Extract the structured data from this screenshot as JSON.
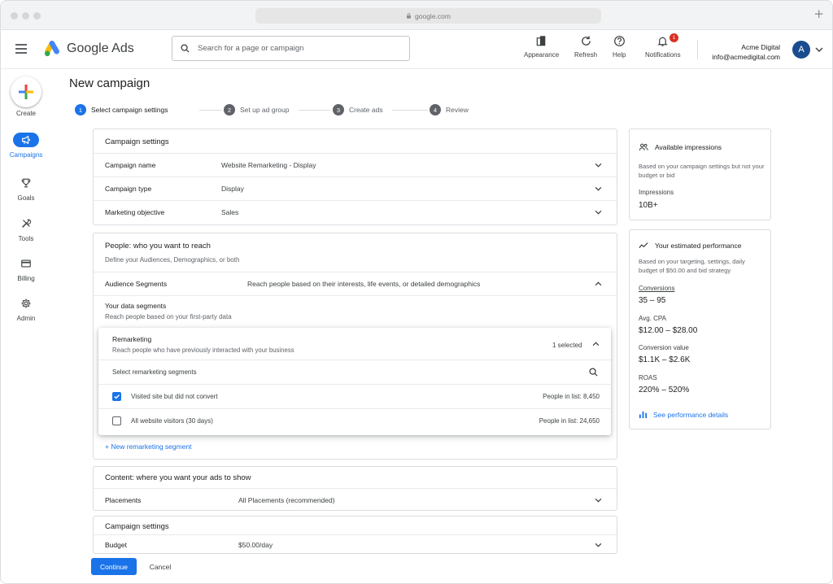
{
  "browser": {
    "url": "google.com",
    "new_tab_symbol": "+"
  },
  "app": {
    "brand": "Google Ads"
  },
  "header": {
    "search_placeholder": "Search for a page or campaign",
    "tools": [
      {
        "label": "Appearance",
        "icon": "appearance-icon"
      },
      {
        "label": "Refresh",
        "icon": "refresh-icon"
      },
      {
        "label": "Help",
        "icon": "help-icon"
      },
      {
        "label": "Notifications",
        "icon": "bell-icon",
        "badge": "1"
      }
    ],
    "account_name": "Acme Digital",
    "account_email": "info@acmedigital.com",
    "avatar_initial": "A"
  },
  "nav": {
    "create_label": "Create",
    "items": [
      {
        "label": "Campaigns",
        "icon": "megaphone-icon",
        "active": true
      },
      {
        "label": "Goals",
        "icon": "trophy-icon"
      },
      {
        "label": "Tools",
        "icon": "tools-icon"
      },
      {
        "label": "Billing",
        "icon": "credit-card-icon"
      },
      {
        "label": "Admin",
        "icon": "gear-icon"
      }
    ]
  },
  "page": {
    "title": "New campaign"
  },
  "steps": [
    {
      "num": "1",
      "label": "Select campaign settings",
      "active": true
    },
    {
      "num": "2",
      "label": "Set up ad group"
    },
    {
      "num": "3",
      "label": "Create ads"
    },
    {
      "num": "4",
      "label": "Review"
    }
  ],
  "campaign_settings": {
    "title": "Campaign settings",
    "rows": [
      {
        "label": "Campaign name",
        "value": "Website Remarketing - Display"
      },
      {
        "label": "Campaign type",
        "value": "Display"
      },
      {
        "label": "Marketing objective",
        "value": "Sales"
      }
    ]
  },
  "people": {
    "title": "People: who you want to reach",
    "subtitle": "Define your Audiences, Demographics, or both",
    "audience_label": "Audience Segments",
    "audience_value": "Reach people based on their interests, life events, or detailed demographics",
    "data_segments_title": "Your data segments",
    "data_segments_sub": "Reach people based on your first-party data",
    "new_segment_link": "+ New remarketing segment"
  },
  "remarketing": {
    "title": "Remarketing",
    "subtitle": "Reach people who have previously interacted with your business",
    "selected": "1 selected",
    "search_placeholder": "Select remarketing segments",
    "options": [
      {
        "label": "Visited site but did not convert",
        "count": "People in list:  8,450",
        "checked": true
      },
      {
        "label": "All website visitors (30 days)",
        "count": "People in list:  24,650",
        "checked": false
      }
    ]
  },
  "content": {
    "title": "Content: where you want your ads to show",
    "placements_label": "Placements",
    "placements_value": "All Placements (recommended)"
  },
  "campaign_settings_2": {
    "title": "Campaign settings",
    "budget_label": "Budget",
    "budget_value": "$50.00/day"
  },
  "impressions_panel": {
    "title": "Available impressions",
    "text": "Based on your campaign settings but not your budget or bid",
    "label": "Impressions",
    "value": "10B+"
  },
  "performance_panel": {
    "title": "Your estimated performance",
    "text": "Based on your targeting, settings, daily budget of $50.00 and bid strategy",
    "metrics": [
      {
        "label": "Conversions",
        "value": "35 – 95"
      },
      {
        "label": "Avg. CPA",
        "value": "$12.00 – $28.00"
      },
      {
        "label": "Conversion value",
        "value": "$1.1K – $2.6K"
      },
      {
        "label": "ROAS",
        "value": "220% – 520%"
      }
    ],
    "details_link": "See performance details"
  },
  "actions": {
    "continue": "Continue",
    "cancel": "Cancel"
  },
  "colors": {
    "accent": "#1a73e8",
    "badge": "#d93025",
    "avatar": "#1a4d8f"
  }
}
